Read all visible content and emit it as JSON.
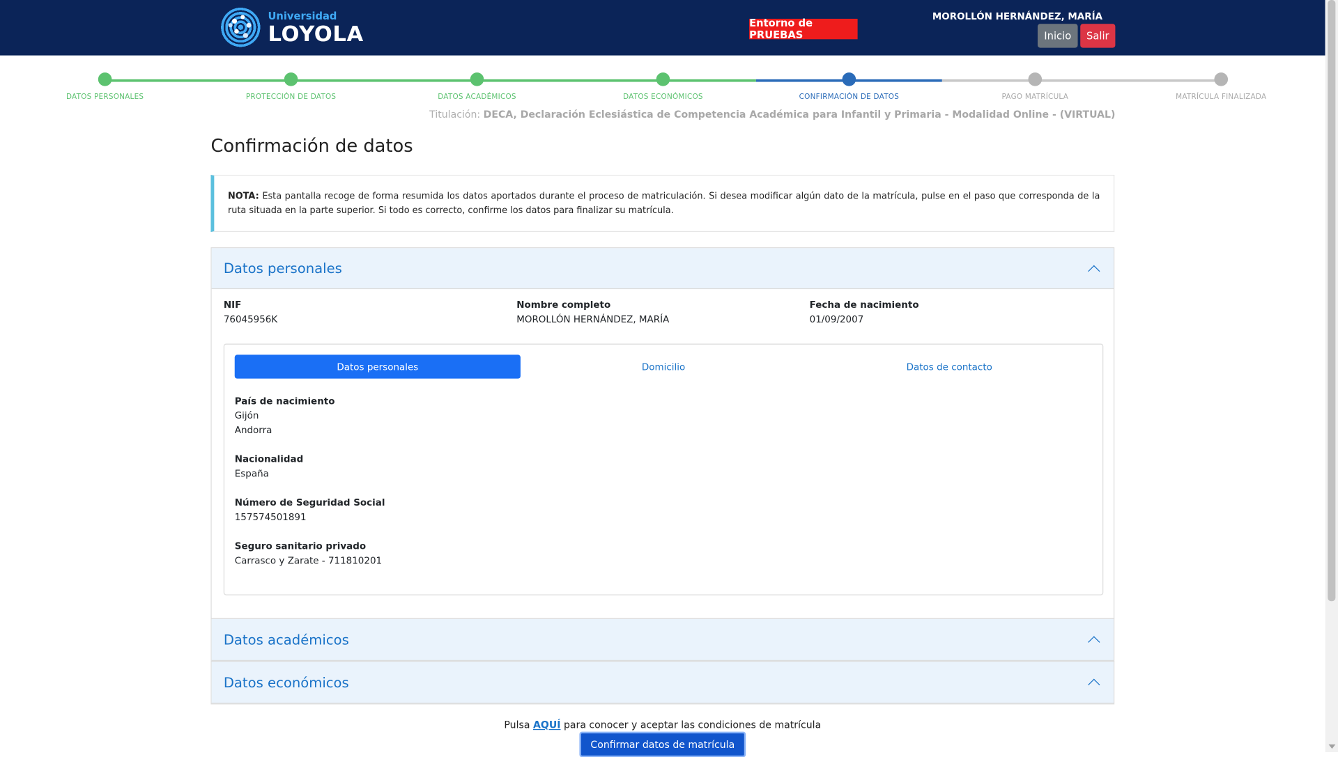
{
  "header": {
    "logo_small": "Universidad",
    "logo_big": "LOYOLA",
    "env_badge": "Entorno de PRUEBAS",
    "user_name": "MOROLLÓN HERNÁNDEZ, MARÍA",
    "inicio_label": "Inicio",
    "salir_label": "Salir"
  },
  "stepper": {
    "steps": [
      {
        "label": "DATOS PERSONALES",
        "state": "done"
      },
      {
        "label": "PROTECCIÓN DE DATOS",
        "state": "done"
      },
      {
        "label": "DATOS ACADÉMICOS",
        "state": "done"
      },
      {
        "label": "DATOS ECONÓMICOS",
        "state": "done"
      },
      {
        "label": "CONFIRMACIÓN DE DATOS",
        "state": "active"
      },
      {
        "label": "PAGO MATRÍCULA",
        "state": "todo"
      },
      {
        "label": "MATRÍCULA FINALIZADA",
        "state": "todo"
      }
    ]
  },
  "titulacion": {
    "prefix": "Titulación:",
    "value": "DECA, Declaración Eclesiástica de Competencia Académica para Infantil y Primaria - Modalidad Online - (VIRTUAL)"
  },
  "page_title": "Confirmación de datos",
  "note": {
    "label": "NOTA:",
    "text": " Esta pantalla recoge de forma resumida los datos aportados durante el proceso de matriculación. Si desea modificar algún dato de la matrícula, pulse en el paso que corresponda de la ruta situada en la parte superior. Si todo es correcto, confirme los datos para finalizar su matrícula."
  },
  "personal": {
    "title": "Datos personales",
    "nif_label": "NIF",
    "nif_value": "76045956K",
    "name_label": "Nombre completo",
    "name_value": "MOROLLÓN HERNÁNDEZ, MARÍA",
    "birth_label": "Fecha de nacimiento",
    "birth_value": "01/09/2007",
    "tabs": [
      "Datos personales",
      "Domicilio",
      "Datos de contacto"
    ],
    "fields": {
      "pais_label": "País de nacimiento",
      "pais_line1": "Gijón",
      "pais_line2": "Andorra",
      "nac_label": "Nacionalidad",
      "nac_value": "España",
      "nss_label": "Número de Seguridad Social",
      "nss_value": "157574501891",
      "seguro_label": "Seguro sanitario privado",
      "seguro_value": "Carrasco y Zarate - 711810201"
    }
  },
  "academicos_title": "Datos académicos",
  "economicos_title": "Datos económicos",
  "footer": {
    "pre": "Pulsa ",
    "link": "AQUÍ",
    "post": " para conocer y aceptar las condiciones de matrícula",
    "confirm_label": "Confirmar datos de matrícula"
  },
  "colors": {
    "header_bg": "#0b2458",
    "step_done": "#5cc26f",
    "step_active": "#2a6bb8",
    "step_todo": "#b5b5b5",
    "accent": "#1a73c8"
  }
}
